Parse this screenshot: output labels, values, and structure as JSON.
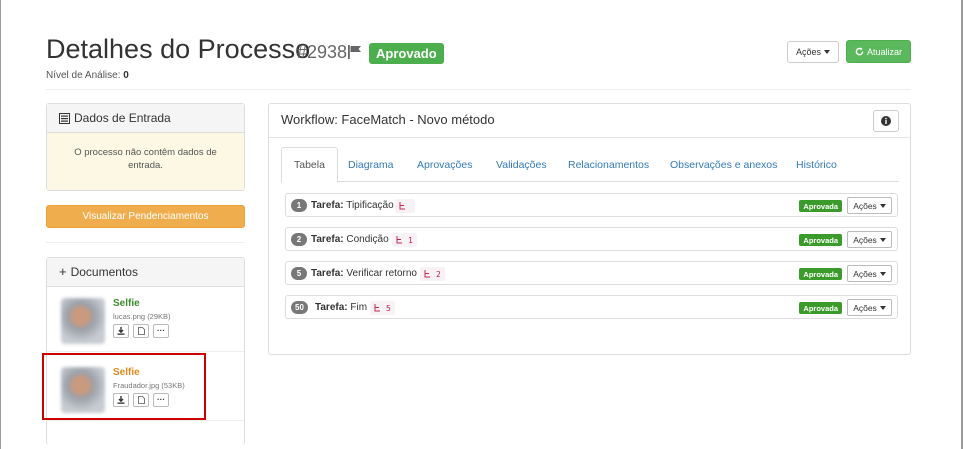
{
  "header": {
    "title": "Detalhes do Processo",
    "process_id": "#2938",
    "status": "Aprovado",
    "level_label": "Nível de Análise:",
    "level_value": "0",
    "actions_label": "Ações",
    "refresh_label": "Atualizar"
  },
  "entrada": {
    "title": "Dados de Entrada",
    "empty_message": "O processo não contêm dados de entrada."
  },
  "pendencias_button": "Visualizar Pendenciamentos",
  "documents": {
    "title": "Documentos",
    "items": [
      {
        "name": "Selfie",
        "file": "lucas.png (29KB)"
      },
      {
        "name": "Selfie",
        "file": "Fraudador.jpg (53KB)"
      }
    ]
  },
  "workflow": {
    "title": "Workflow: FaceMatch - Novo método",
    "tabs": [
      "Tabela",
      "Diagrama",
      "Aprovações",
      "Validações",
      "Relacionamentos",
      "Observações e anexos",
      "Histórico"
    ],
    "task_prefix": "Tarefa:",
    "tasks": [
      {
        "num": "1",
        "name": "Tipificação",
        "tag": "",
        "status": "Aprovada",
        "actions": "Ações"
      },
      {
        "num": "2",
        "name": "Condição",
        "tag": "1",
        "status": "Aprovada",
        "actions": "Ações"
      },
      {
        "num": "5",
        "name": "Verificar retorno",
        "tag": "2",
        "status": "Aprovada",
        "actions": "Ações"
      },
      {
        "num": "50",
        "name": "Fim",
        "tag": "5",
        "status": "Aprovada",
        "actions": "Ações"
      }
    ]
  },
  "colors": {
    "success": "#5cb85c",
    "warning": "#f0ad4e",
    "link": "#337ab7",
    "highlight": "#cc0000"
  }
}
